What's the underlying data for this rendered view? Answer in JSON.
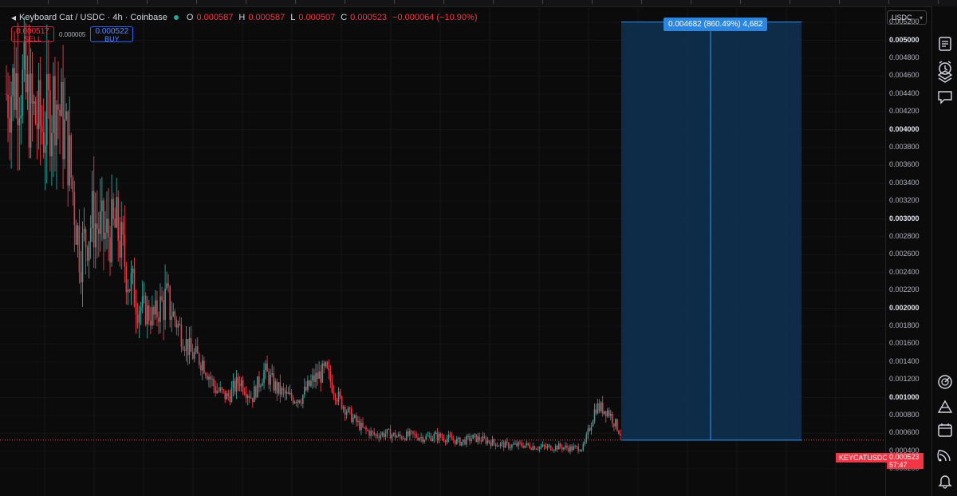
{
  "header": {
    "symbol": "Keyboard Cat / USDC · 4h · Coinbase",
    "ohlc": [
      {
        "key": "O",
        "value": "0.000587"
      },
      {
        "key": "H",
        "value": "0.000587"
      },
      {
        "key": "L",
        "value": "0.000507"
      },
      {
        "key": "C",
        "value": "0.000523"
      }
    ],
    "change": "−0.000064 (−10.90%)"
  },
  "trade": {
    "sell_price": "0.000517",
    "sell_label": "SELL",
    "spread": "0.000005",
    "buy_price": "0.000522",
    "buy_label": "BUY"
  },
  "price_axis": {
    "currency": "USDC",
    "labels": [
      "0.005200",
      "0.005000",
      "0.004800",
      "0.004600",
      "0.004400",
      "0.004200",
      "0.004000",
      "0.003800",
      "0.003600",
      "0.003400",
      "0.003200",
      "0.003000",
      "0.002800",
      "0.002600",
      "0.002400",
      "0.002200",
      "0.002000",
      "0.001800",
      "0.001600",
      "0.001400",
      "0.001200",
      "0.001000",
      "0.000800",
      "0.000600",
      "0.000400",
      "0.000200"
    ],
    "major_labels": [
      "0.005000",
      "0.004000",
      "0.003000",
      "0.002000",
      "0.001000"
    ]
  },
  "measure": {
    "label": "0.004682 (860.49%) 4,682",
    "from_price": 0.000523,
    "to_price": 0.005205
  },
  "current_price": {
    "symbol_tag": "KEYCATUSDC",
    "value": "0.000523",
    "countdown": "57:47",
    "price": 0.000523
  },
  "colors": {
    "up": "#26a69a",
    "down": "#f23645",
    "measure_fill": "#0f3152",
    "measure_line": "#2a86e0"
  },
  "icons": [
    "list-icon",
    "alarm-clock-icon",
    "layers-icon",
    "chat-icon",
    "target-icon",
    "triangle-icon",
    "calendar-icon",
    "broadcast-icon",
    "bell-icon"
  ],
  "chart_data": {
    "type": "candlestick",
    "series_shape": [
      [
        0,
        0.0044
      ],
      [
        1,
        0.0046
      ],
      [
        2,
        0.0042
      ],
      [
        3,
        0.004
      ],
      [
        4,
        0.0044
      ],
      [
        5,
        0.0038
      ],
      [
        6,
        0.0026
      ],
      [
        7,
        0.003
      ],
      [
        8,
        0.0028
      ],
      [
        9,
        0.0029
      ],
      [
        10,
        0.0023
      ],
      [
        11,
        0.002
      ],
      [
        12,
        0.0019
      ],
      [
        13,
        0.0021
      ],
      [
        14,
        0.0018
      ],
      [
        15,
        0.0015
      ],
      [
        16,
        0.0014
      ],
      [
        17,
        0.0011
      ],
      [
        18,
        0.001
      ],
      [
        19,
        0.0012
      ],
      [
        20,
        0.001
      ],
      [
        21,
        0.0013
      ],
      [
        22,
        0.0011
      ],
      [
        23,
        0.001
      ],
      [
        24,
        0.001
      ],
      [
        25,
        0.0012
      ],
      [
        26,
        0.0013
      ],
      [
        27,
        0.001
      ],
      [
        28,
        0.0008
      ],
      [
        29,
        0.00065
      ],
      [
        30,
        0.00058
      ],
      [
        31,
        0.0006
      ],
      [
        32,
        0.00056
      ],
      [
        33,
        0.00058
      ],
      [
        34,
        0.00055
      ],
      [
        35,
        0.00057
      ],
      [
        36,
        0.00054
      ],
      [
        37,
        0.0005
      ],
      [
        38,
        0.00055
      ],
      [
        39,
        0.00052
      ],
      [
        40,
        0.00048
      ],
      [
        41,
        0.00046
      ],
      [
        42,
        0.00047
      ],
      [
        43,
        0.00045
      ],
      [
        44,
        0.00044
      ],
      [
        45,
        0.00045
      ],
      [
        46,
        0.00043
      ],
      [
        47,
        0.00044
      ],
      [
        48,
        0.0009
      ],
      [
        49,
        0.00085
      ],
      [
        50,
        0.0006
      ]
    ],
    "ylim": [
      0.0002,
      0.0052
    ]
  }
}
